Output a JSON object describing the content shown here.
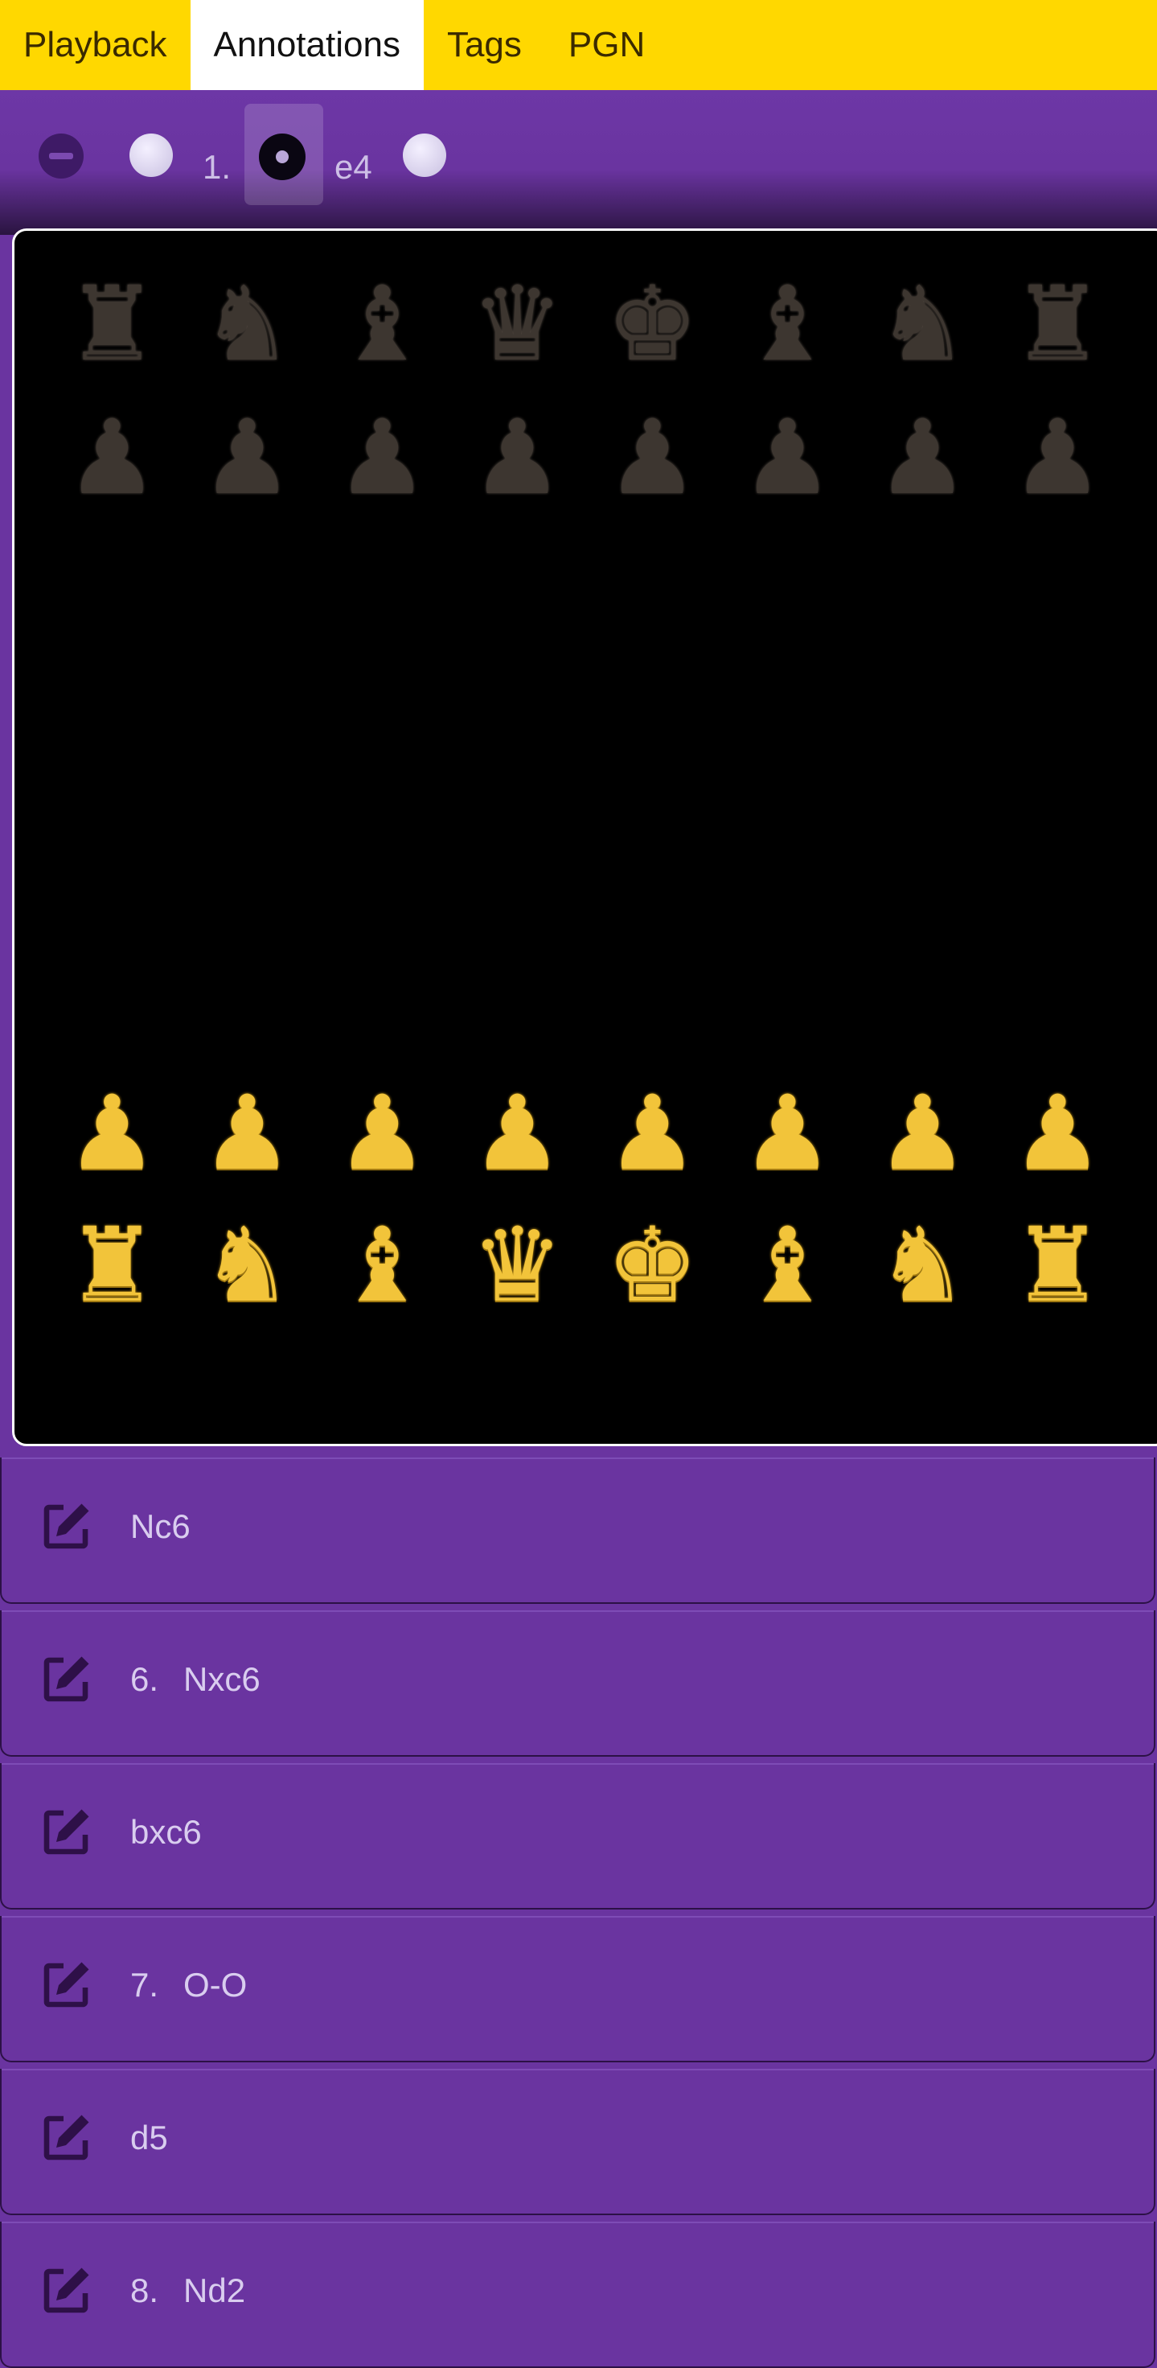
{
  "tabs": [
    {
      "label": "Playback"
    },
    {
      "label": "Annotations"
    },
    {
      "label": "Tags"
    },
    {
      "label": "PGN"
    }
  ],
  "controls": {
    "move_number": "1.",
    "move_san": "e4"
  },
  "board": {
    "black_back_rank": [
      "♜",
      "♞",
      "♝",
      "♛",
      "♚",
      "♝",
      "♞",
      "♜"
    ],
    "black_pawns": [
      "♟",
      "♟",
      "♟",
      "♟",
      "♟",
      "♟",
      "♟",
      "♟"
    ],
    "white_pawns": [
      "♟",
      "♟",
      "♟",
      "♟",
      "♟",
      "♟",
      "♟",
      "♟"
    ],
    "white_back_rank": [
      "♜",
      "♞",
      "♝",
      "♛",
      "♚",
      "♝",
      "♞",
      "♜"
    ]
  },
  "moves": [
    {
      "num": "",
      "san": "Nc6"
    },
    {
      "num": "6.",
      "san": "Nxc6"
    },
    {
      "num": "",
      "san": "bxc6"
    },
    {
      "num": "7.",
      "san": "O-O"
    },
    {
      "num": "",
      "san": "d5"
    },
    {
      "num": "8.",
      "san": "Nd2"
    }
  ],
  "colors": {
    "tab_bar": "#ffd800",
    "panel": "#6a34a0",
    "board": "#000000",
    "white_piece": "#f2c43a",
    "black_piece": "#3d3630"
  }
}
